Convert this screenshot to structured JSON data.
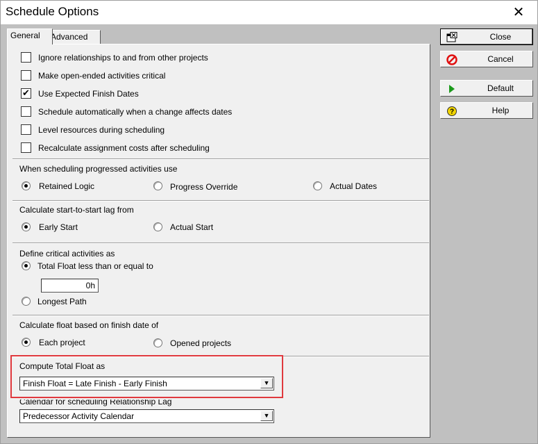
{
  "window": {
    "title": "Schedule Options",
    "close_glyph": "✕"
  },
  "tabs": [
    {
      "label": "General",
      "active": true
    },
    {
      "label": "Advanced",
      "active": false
    }
  ],
  "checkboxes": [
    {
      "label": "Ignore relationships to and from other projects",
      "checked": false
    },
    {
      "label": "Make open-ended activities critical",
      "checked": false
    },
    {
      "label": "Use Expected Finish Dates",
      "checked": true
    },
    {
      "label": "Schedule automatically when a change affects dates",
      "checked": false
    },
    {
      "label": "Level resources during scheduling",
      "checked": false
    },
    {
      "label": "Recalculate assignment costs after scheduling",
      "checked": false
    }
  ],
  "check_glyph": "✔",
  "progressed": {
    "heading": "When scheduling progressed activities use",
    "options": [
      {
        "label": "Retained Logic",
        "selected": true
      },
      {
        "label": "Progress Override",
        "selected": false
      },
      {
        "label": "Actual Dates",
        "selected": false
      }
    ]
  },
  "lag": {
    "heading": "Calculate start-to-start lag from",
    "options": [
      {
        "label": "Early Start",
        "selected": true
      },
      {
        "label": "Actual Start",
        "selected": false
      }
    ]
  },
  "critical": {
    "heading": "Define critical activities as",
    "options": [
      {
        "label": "Total Float less than or equal to",
        "selected": true
      },
      {
        "label": "Longest Path",
        "selected": false
      }
    ],
    "float_value": "0h"
  },
  "float_basis": {
    "heading": "Calculate float based on finish date of",
    "options": [
      {
        "label": "Each project",
        "selected": true
      },
      {
        "label": "Opened projects",
        "selected": false
      }
    ]
  },
  "total_float": {
    "heading": "Compute Total Float as",
    "value": "Finish Float = Late Finish - Early Finish"
  },
  "calendar": {
    "heading": "Calendar for scheduling Relationship Lag",
    "value": "Predecessor Activity Calendar"
  },
  "dropdown_glyph": "▼",
  "buttons": [
    {
      "label": "Close",
      "icon": "close-window-icon"
    },
    {
      "label": "Cancel",
      "icon": "cancel-icon"
    },
    {
      "label": "Default",
      "icon": "default-play-icon"
    },
    {
      "label": "Help",
      "icon": "help-icon"
    }
  ],
  "colors": {
    "highlight": "#e0393e",
    "cancel_red": "#e01010",
    "default_green": "#1a9a1a",
    "help_yellow": "#f2d500"
  }
}
